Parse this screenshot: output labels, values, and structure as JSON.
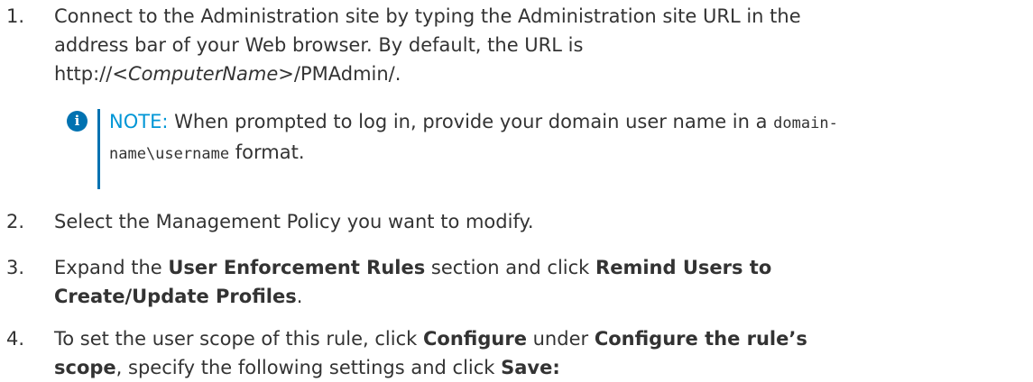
{
  "step1": {
    "number": "1.",
    "line1": "Connect to the Administration site by typing the Administration site URL in the",
    "line2": "address bar of your Web browser. By default, the URL is",
    "url_prefix": "http://<",
    "url_variable": "ComputerName",
    "url_suffix": ">/PMAdmin/."
  },
  "note": {
    "icon": "info-icon",
    "label": "NOTE:",
    "text1": "When prompted to log in, provide your domain user name in a",
    "code1": "domain-",
    "code2": "name\\username",
    "text2": "format."
  },
  "step2": {
    "number": "2.",
    "text": "Select the Management Policy you want to modify."
  },
  "step3": {
    "number": "3.",
    "text1": "Expand the",
    "bold1": "User Enforcement Rules",
    "text2": "section and click",
    "bold2a": "Remind Users to",
    "bold2b": "Create/Update Profiles",
    "text3": "."
  },
  "step4": {
    "number": "4.",
    "text1": "To set the user scope of this rule, click",
    "bold1": "Configure",
    "text2": "under",
    "bold2a": "Configure the rule’s",
    "bold2b": "scope",
    "text3": ", specify the following settings and click",
    "bold3": "Save:"
  },
  "colors": {
    "accent": "#0072b1",
    "note_label": "#0096d6",
    "text": "#333333"
  }
}
